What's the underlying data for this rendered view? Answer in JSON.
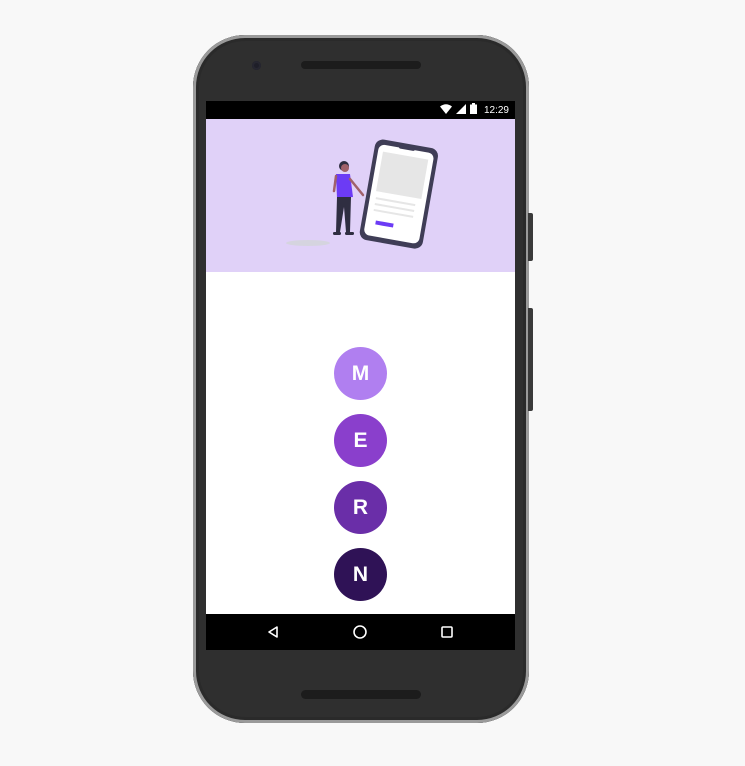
{
  "status_bar": {
    "time": "12:29",
    "icons": [
      "wifi-icon",
      "signal-icon",
      "battery-icon"
    ]
  },
  "hero": {
    "illustration": "person-with-phone-illustration",
    "background_color": "#e0d1f8"
  },
  "letters": [
    {
      "label": "M",
      "color": "#b07ff0"
    },
    {
      "label": "E",
      "color": "#8a3fcc"
    },
    {
      "label": "R",
      "color": "#6a2ea8"
    },
    {
      "label": "N",
      "color": "#2f1256"
    }
  ],
  "nav_bar": {
    "buttons": [
      "back-icon",
      "home-icon",
      "recents-icon"
    ]
  }
}
